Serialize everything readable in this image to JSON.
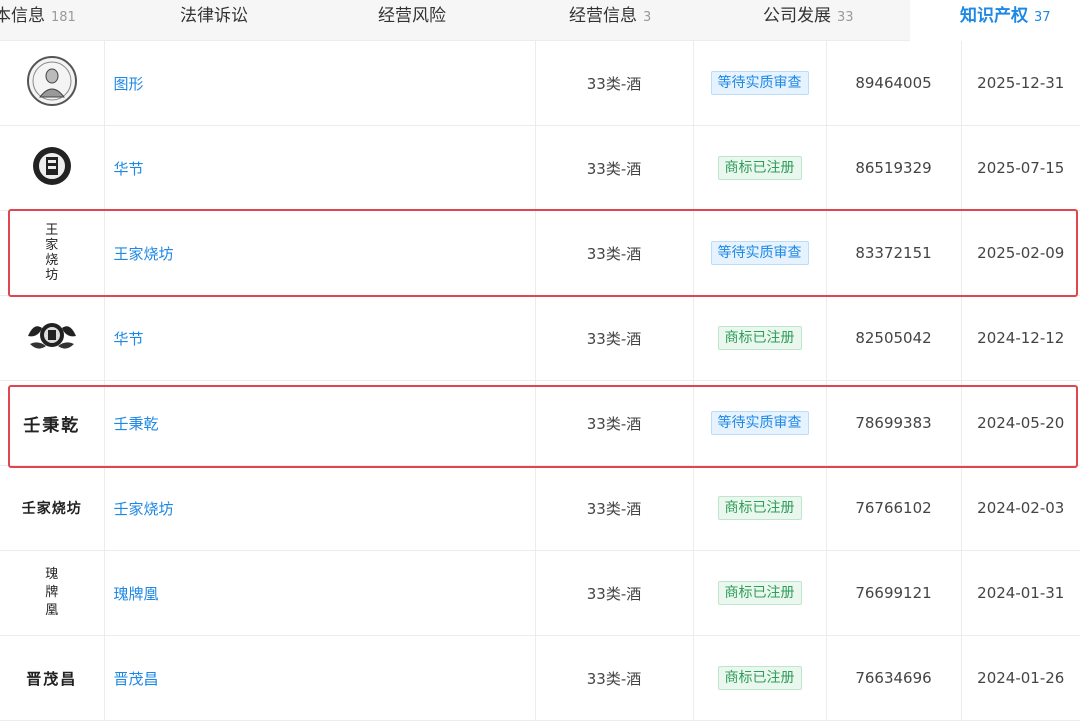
{
  "tabs": [
    {
      "label": "本信息",
      "count": "181",
      "active": false
    },
    {
      "label": "法律诉讼",
      "count": "",
      "active": false
    },
    {
      "label": "经营风险",
      "count": "",
      "active": false
    },
    {
      "label": "经营信息",
      "count": "3",
      "active": false
    },
    {
      "label": "公司发展",
      "count": "33",
      "active": false
    },
    {
      "label": "知识产权",
      "count": "37",
      "active": true
    }
  ],
  "trademarks": [
    {
      "logo": "portrait-seal-logo",
      "logo_text": "",
      "name": "图形",
      "class": "33类-酒",
      "status": "等待实质审查",
      "status_type": "pending",
      "reg_no": "89464005",
      "date": "2025-12-31"
    },
    {
      "logo": "round-seal-logo",
      "logo_text": "",
      "name": "华节",
      "class": "33类-酒",
      "status": "商标已注册",
      "status_type": "registered",
      "reg_no": "86519329",
      "date": "2025-07-15"
    },
    {
      "logo": "vertical-calligraphy-logo",
      "logo_text": "王家烧坊",
      "name": "王家烧坊",
      "class": "33类-酒",
      "status": "等待实质审查",
      "status_type": "pending",
      "reg_no": "83372151",
      "date": "2025-02-09"
    },
    {
      "logo": "ornate-emblem-logo",
      "logo_text": "",
      "name": "华节",
      "class": "33类-酒",
      "status": "商标已注册",
      "status_type": "registered",
      "reg_no": "82505042",
      "date": "2024-12-12"
    },
    {
      "logo": "text-logo",
      "logo_text": "壬秉乾",
      "name": "壬秉乾",
      "class": "33类-酒",
      "status": "等待实质审查",
      "status_type": "pending",
      "reg_no": "78699383",
      "date": "2024-05-20"
    },
    {
      "logo": "text-logo-small",
      "logo_text": "壬家烧坊",
      "name": "壬家烧坊",
      "class": "33类-酒",
      "status": "商标已注册",
      "status_type": "registered",
      "reg_no": "76766102",
      "date": "2024-02-03"
    },
    {
      "logo": "vertical-text-logo",
      "logo_text": "瑰牌凰",
      "name": "瑰牌凰",
      "class": "33类-酒",
      "status": "商标已注册",
      "status_type": "registered",
      "reg_no": "76699121",
      "date": "2024-01-31"
    },
    {
      "logo": "text-logo",
      "logo_text": "晋茂昌",
      "name": "晋茂昌",
      "class": "33类-酒",
      "status": "商标已注册",
      "status_type": "registered",
      "reg_no": "76634696",
      "date": "2024-01-26"
    }
  ],
  "colors": {
    "accent": "#1e88e5",
    "highlight": "#e0464f",
    "registered": "#2f9e59"
  }
}
